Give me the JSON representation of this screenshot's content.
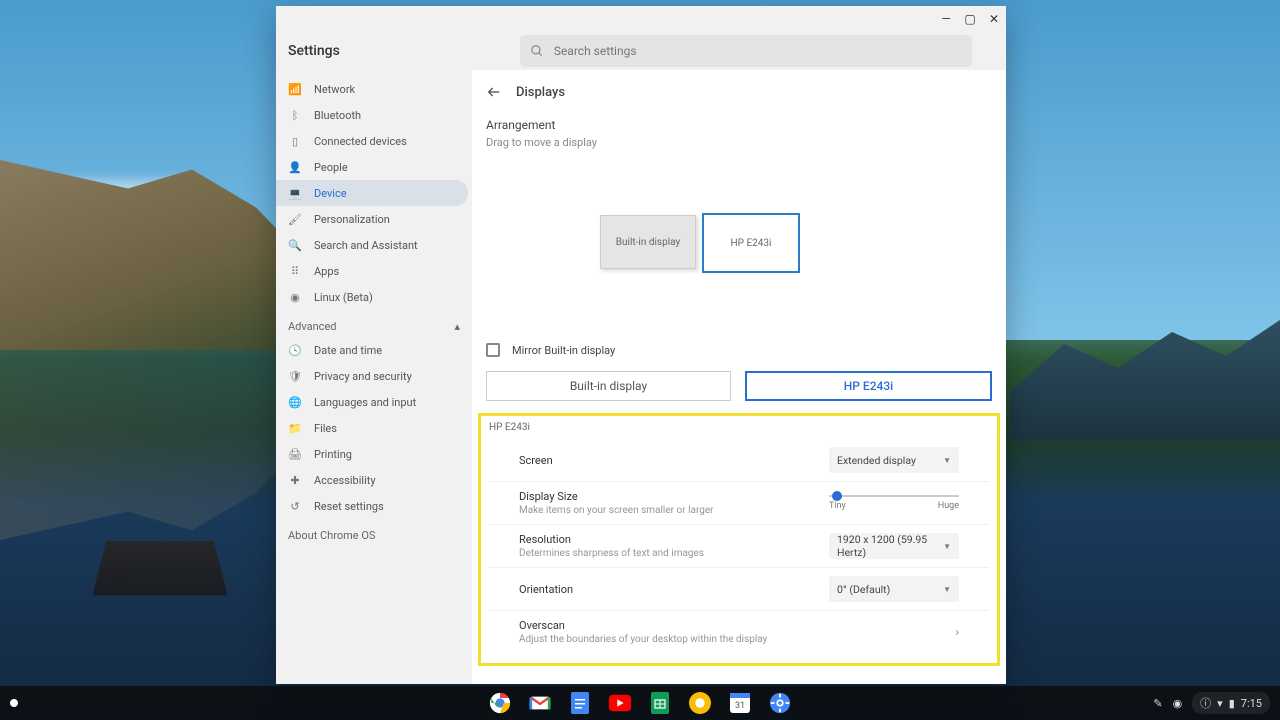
{
  "window": {
    "title": "Settings",
    "search_placeholder": "Search settings"
  },
  "sidebar": {
    "main": [
      {
        "icon": "wifi",
        "label": "Network"
      },
      {
        "icon": "bluetooth",
        "label": "Bluetooth"
      },
      {
        "icon": "phone",
        "label": "Connected devices"
      },
      {
        "icon": "person",
        "label": "People"
      },
      {
        "icon": "laptop",
        "label": "Device"
      },
      {
        "icon": "brush",
        "label": "Personalization"
      },
      {
        "icon": "search",
        "label": "Search and Assistant"
      },
      {
        "icon": "apps",
        "label": "Apps"
      },
      {
        "icon": "linux",
        "label": "Linux (Beta)"
      }
    ],
    "advanced_label": "Advanced",
    "advanced": [
      {
        "icon": "clock",
        "label": "Date and time"
      },
      {
        "icon": "shield",
        "label": "Privacy and security"
      },
      {
        "icon": "globe",
        "label": "Languages and input"
      },
      {
        "icon": "folder",
        "label": "Files"
      },
      {
        "icon": "printer",
        "label": "Printing"
      },
      {
        "icon": "a11y",
        "label": "Accessibility"
      },
      {
        "icon": "reset",
        "label": "Reset settings"
      }
    ],
    "about": "About Chrome OS"
  },
  "page": {
    "title": "Displays",
    "arrangement_label": "Arrangement",
    "arrangement_hint": "Drag to move a display",
    "display_builtin": "Built-in display",
    "display_ext": "HP E243i",
    "mirror_label": "Mirror Built-in display",
    "tabs": {
      "builtin": "Built-in display",
      "ext": "HP E243i"
    },
    "highlight_title": "HP E243i",
    "settings": {
      "screen": {
        "name": "Screen",
        "value": "Extended display"
      },
      "display_size": {
        "name": "Display Size",
        "desc": "Make items on your screen smaller or larger",
        "min": "Tiny",
        "max": "Huge"
      },
      "resolution": {
        "name": "Resolution",
        "desc": "Determines sharpness of text and images",
        "value": "1920 x 1200 (59.95 Hertz)"
      },
      "orientation": {
        "name": "Orientation",
        "value": "0° (Default)"
      },
      "overscan": {
        "name": "Overscan",
        "desc": "Adjust the boundaries of your desktop within the display"
      }
    }
  },
  "shelf": {
    "time": "7:15"
  }
}
